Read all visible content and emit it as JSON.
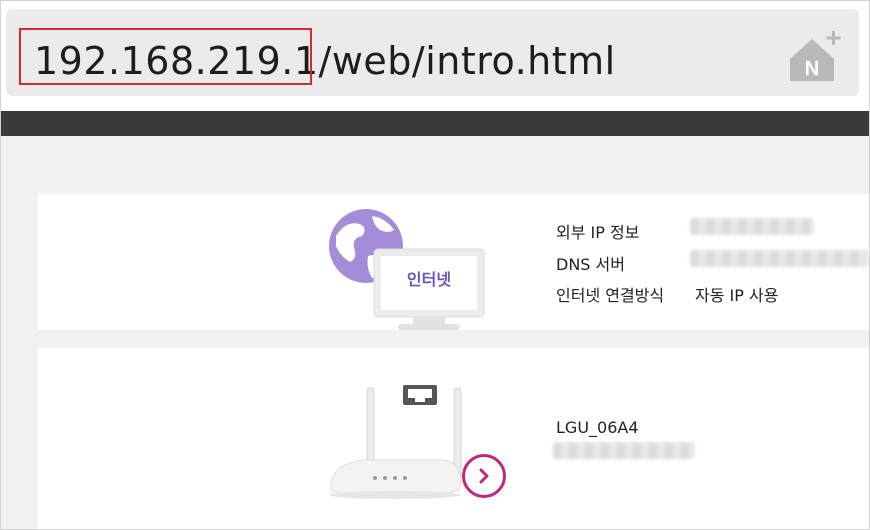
{
  "address_bar": {
    "url_highlighted": "192.168.219.1/",
    "url_rest": "web/intro.html",
    "icon": "naver-add-home-icon"
  },
  "internet_card": {
    "illustration_label": "인터넷",
    "rows": [
      {
        "label": "외부 IP 정보",
        "value": ""
      },
      {
        "label": "DNS 서버",
        "value": ""
      },
      {
        "label": "인터넷 연결방식",
        "value": "자동 IP 사용"
      }
    ]
  },
  "router_card": {
    "ssid": "LGU_06A4",
    "details_icon": "chevron-right-icon"
  },
  "colors": {
    "highlight": "#d9282f",
    "accent": "#c0287a",
    "globe": "#a48cd8",
    "dark_band": "#3a3a3a"
  }
}
